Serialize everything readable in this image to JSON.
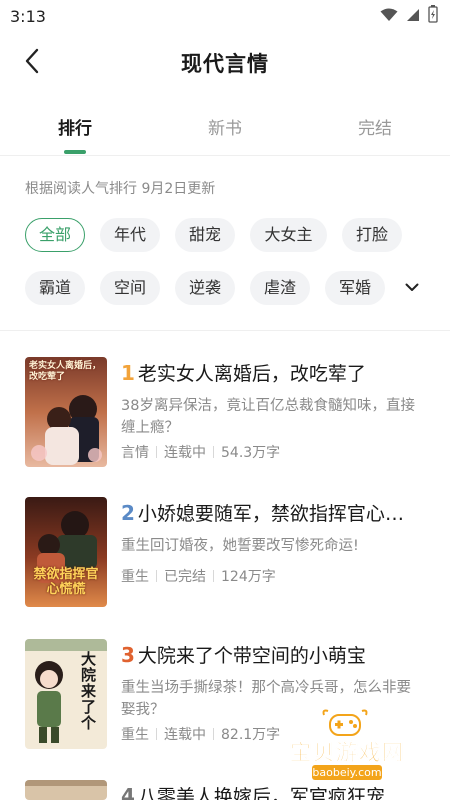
{
  "status_bar": {
    "time": "3:13",
    "icons": [
      "wifi-icon",
      "cellular-signal-icon",
      "battery-icon"
    ]
  },
  "header": {
    "back_icon": "chevron-left-icon",
    "title": "现代言情"
  },
  "tabs": [
    {
      "label": "排行",
      "active": true
    },
    {
      "label": "新书",
      "active": false
    },
    {
      "label": "完结",
      "active": false
    }
  ],
  "update_note": "根据阅读人气排行 9月2日更新",
  "filters": {
    "chips": [
      {
        "label": "全部",
        "active": true
      },
      {
        "label": "年代"
      },
      {
        "label": "甜宠"
      },
      {
        "label": "大女主"
      },
      {
        "label": "打脸"
      },
      {
        "label": "霸道"
      },
      {
        "label": "空间"
      },
      {
        "label": "逆袭"
      },
      {
        "label": "虐渣"
      },
      {
        "label": "军婚"
      }
    ],
    "expand_icon": "chevron-down-icon"
  },
  "books": [
    {
      "rank": "1",
      "title": "老实女人离婚后，改吃荤了",
      "desc": "38岁离异保洁，竟让百亿总裁食髓知味，直接缠上瘾？",
      "tag": "言情",
      "status": "连载中",
      "words": "54.3万字",
      "cover_text": "老实女人离婚后，改吃荤了"
    },
    {
      "rank": "2",
      "title": "小娇媳要随军，禁欲指挥官心慌慌",
      "desc": "重生回订婚夜，她誓要改写惨死命运!",
      "tag": "重生",
      "status": "已完结",
      "words": "124万字",
      "cover_text": "禁欲指挥官心慌慌"
    },
    {
      "rank": "3",
      "title": "大院来了个带空间的小萌宝",
      "desc": "重生当场手撕绿茶！那个高冷兵哥，怎么非要娶我？",
      "tag": "重生",
      "status": "连载中",
      "words": "82.1万字",
      "cover_text": "大院来了个"
    },
    {
      "rank": "4",
      "title": "八零美人换嫁后，军官疯狂宠",
      "desc": "",
      "tag": "",
      "status": "",
      "words": "",
      "cover_text": ""
    }
  ],
  "colors": {
    "accent": "#3aa06a",
    "rank1": "#f2a33a",
    "rank2": "#5a8ac6",
    "rank3": "#e0622f",
    "rank4": "#777777"
  },
  "watermark": {
    "text": "宝贝游戏网",
    "url": "baobeiy.com"
  }
}
